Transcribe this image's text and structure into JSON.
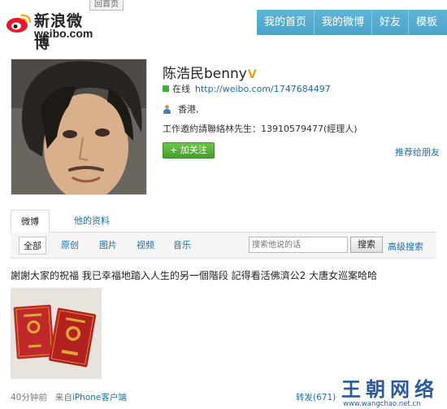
{
  "header": {
    "logo_cn": "新浪微博",
    "logo_en": "weibo.com",
    "back_home": "回首页",
    "nav": [
      "我的首页",
      "我的微博",
      "好友",
      "模板"
    ]
  },
  "profile": {
    "name": "陈浩民benny",
    "verified_badge": "V",
    "online_status": "在线",
    "url": "http://weibo.com/1747684497",
    "location": "香港,",
    "bio": "工作邀約請聯絡林先生：13910579477(經理人)",
    "follow_button": "+ 加关注",
    "recommend_link": "推荐给朋友"
  },
  "tabs": [
    "微博",
    "他的资料"
  ],
  "filters": [
    "全部",
    "原创",
    "图片",
    "视频",
    "音乐"
  ],
  "search": {
    "placeholder": "搜索他说的话",
    "button": "搜索",
    "advanced": "高级搜索"
  },
  "post": {
    "text": "謝謝大家的祝福  我已幸福地踏入人生的另一個階段  記得看活佛濟公2 大唐女巡案哈哈",
    "time": "40分钟前",
    "from_label": "来自",
    "client": "iPhone客户端",
    "repost": "转发(671)",
    "image_caption": "结婚证"
  },
  "watermark": {
    "title": "王朝网络",
    "url": "www.wangchao.net.cn"
  },
  "colors": {
    "nav_bg": "#4aa3c8",
    "link": "#1b6ea8",
    "follow_green": "#45a02b",
    "verified": "#e8a41a",
    "cert_red": "#c0282a"
  }
}
